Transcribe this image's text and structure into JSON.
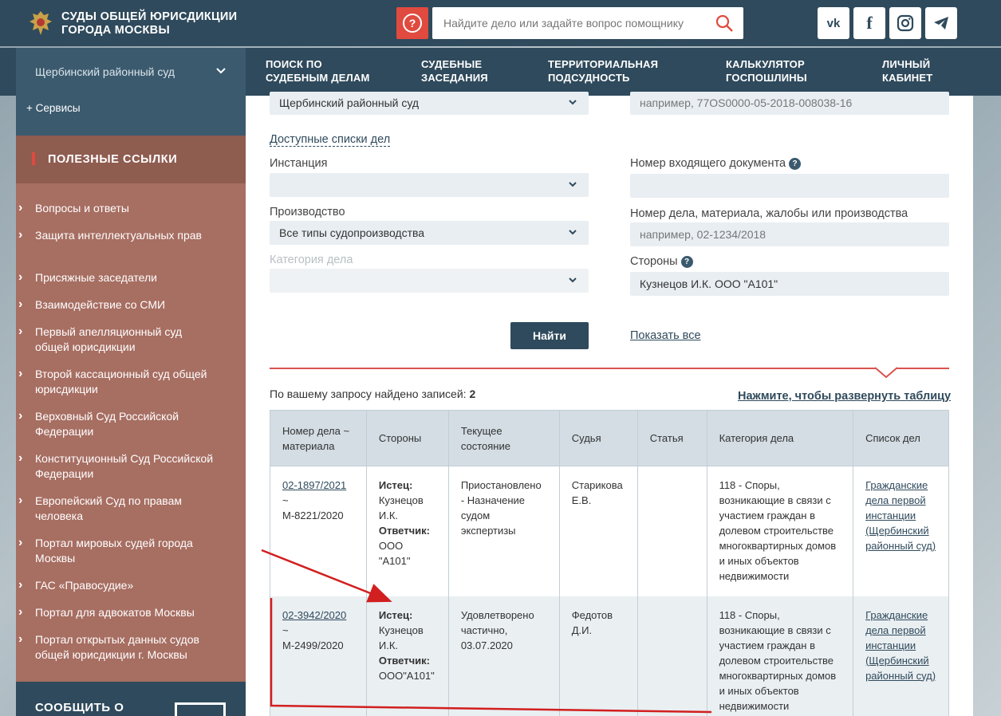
{
  "header": {
    "logo_line1": "СУДЫ ОБЩЕЙ ЮРИСДИКЦИИ",
    "logo_line2": "ГОРОДА МОСКВЫ",
    "search_placeholder": "Найдите дело или задайте вопрос помощнику",
    "social": [
      "vk",
      "f",
      "instagram",
      "telegram"
    ]
  },
  "nav": {
    "court": "Щербинский районный суд",
    "items": [
      {
        "line1": "ПОИСК ПО",
        "line2": "СУДЕБНЫМ ДЕЛАМ"
      },
      {
        "line1": "СУДЕБНЫЕ",
        "line2": "ЗАСЕДАНИЯ"
      },
      {
        "line1": "ТЕРРИТОРИАЛЬНАЯ",
        "line2": "ПОДСУДНОСТЬ"
      },
      {
        "line1": "КАЛЬКУЛЯТОР",
        "line2": "ГОСПОШЛИНЫ"
      },
      {
        "line1": "ЛИЧНЫЙ",
        "line2": "КАБИНЕТ"
      }
    ]
  },
  "sidebar": {
    "services": "+ Сервисы",
    "useful_title": "ПОЛЕЗНЫЕ ССЫЛКИ",
    "links": [
      "Вопросы и ответы",
      "Защита интеллектуальных прав",
      "Присяжные заседатели",
      "Взаимодействие со СМИ",
      "Первый апелляционный суд общей юрисдикции",
      "Второй кассационный суд общей юрисдикции",
      "Верховный Суд Российской Федерации",
      "Конституционный Суд Российской Федерации",
      "Европейский Суд по правам человека",
      "Портал мировых судей города Москвы",
      "ГАС «Правосудие»",
      "Портал для адвокатов Москвы",
      "Портал открытых данных судов общей юрисдикции г. Москвы"
    ],
    "report": "СООБЩИТЬ О"
  },
  "form": {
    "court_value": "Щербинский районный суд",
    "uid_placeholder": "например, 77OS0000-05-2018-008038-16",
    "available_lists": "Доступные списки дел",
    "instance_label": "Инстанция",
    "incoming_label": "Номер входящего документа",
    "production_label": "Производство",
    "production_value": "Все типы судопроизводства",
    "case_number_label": "Номер дела, материала, жалобы или производства",
    "case_number_placeholder": "например, 02-1234/2018",
    "category_label": "Категория дела",
    "parties_label": "Стороны",
    "parties_value": "Кузнецов И.К. ООО \"А101\"",
    "help_mark": "?",
    "find_button": "Найти",
    "show_all": "Показать все"
  },
  "results": {
    "found_text": "По вашему запросу найдено записей:",
    "found_count": "2",
    "expand_link": "Нажмите, чтобы развернуть таблицу",
    "columns": [
      "Номер дела ~ материала",
      "Стороны",
      "Текущее состояние",
      "Судья",
      "Статья",
      "Категория дела",
      "Список дел"
    ],
    "rows": [
      {
        "case": "02-1897/2021",
        "tilde": "~",
        "material": "М-8221/2020",
        "plaintiff_label": "Истец:",
        "plaintiff": "Кузнецов И.К.",
        "defendant_label": "Ответчик:",
        "defendant": "ООО \"А101\"",
        "status": "Приостановлено - Назначение судом экспертизы",
        "judge": "Старикова Е.В.",
        "article": "",
        "category": "118 - Споры, возникающие в связи с участием граждан в долевом строительстве многоквартирных домов и иных объектов недвижимости",
        "list": "Гражданские дела первой инстанции (Щербинский районный суд)"
      },
      {
        "case": "02-3942/2020",
        "tilde": "~",
        "material": "М-2499/2020",
        "plaintiff_label": "Истец:",
        "plaintiff": "Кузнецов И.К.",
        "defendant_label": "Ответчик:",
        "defendant": "ООО\"А101\"",
        "status": "Удовлетворено частично, 03.07.2020",
        "judge": "Федотов Д.И.",
        "article": "",
        "category": "118 - Споры, возникающие в связи с участием граждан в долевом строительстве многоквартирных домов и иных объектов недвижимости",
        "list": "Гражданские дела первой инстанции (Щербинский районный суд)"
      }
    ]
  },
  "colors": {
    "header": "#2f4a5c",
    "accent_red": "#e04a3f",
    "sidebar_links": "#a76e62",
    "annotation": "#d21f1f"
  }
}
